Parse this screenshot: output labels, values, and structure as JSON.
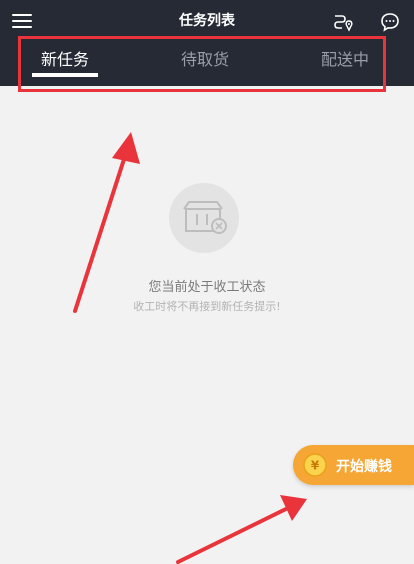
{
  "header": {
    "title": "任务列表",
    "icons": [
      "menu-icon",
      "route-icon",
      "chat-icon"
    ]
  },
  "tabs": [
    {
      "label": "新任务",
      "active": true
    },
    {
      "label": "待取货",
      "active": false
    },
    {
      "label": "配送中",
      "active": false
    }
  ],
  "empty_state": {
    "icon": "closed-box-icon",
    "message": "您当前处于收工状态",
    "sub_message": "收工时将不再接到新任务提示!"
  },
  "floating_button": {
    "label": "开始赚钱",
    "icon": "coin-icon"
  },
  "colors": {
    "header_bg": "#262a35",
    "page_bg": "#f2f2f2",
    "accent": "#f5a634",
    "annotation_red": "#e8343a"
  }
}
